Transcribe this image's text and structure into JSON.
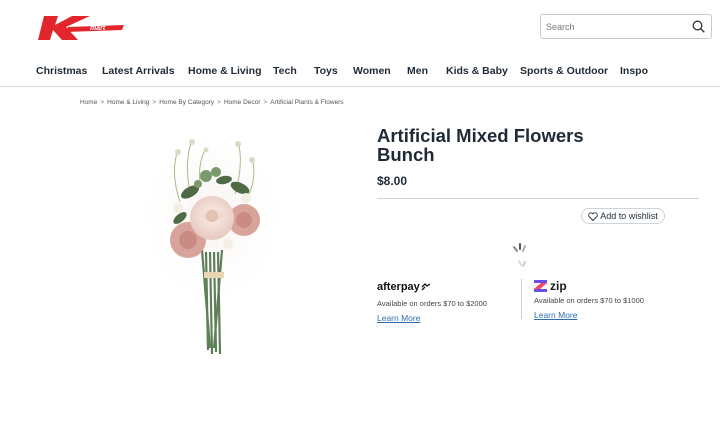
{
  "header": {
    "logo_text": "Kmart",
    "search": {
      "placeholder": "Search",
      "value": ""
    }
  },
  "nav": {
    "items": [
      "Christmas",
      "Latest Arrivals",
      "Home & Living",
      "Tech",
      "Toys",
      "Women",
      "Men",
      "Kids & Baby",
      "Sports & Outdoor",
      "Inspo"
    ]
  },
  "breadcrumb": [
    "Home",
    "Home & Living",
    "Home By Category",
    "Home Decor",
    "Artificial Plants & Flowers"
  ],
  "breadcrumb_separator": ">",
  "product": {
    "title": "Artificial Mixed Flowers Bunch",
    "price": "$8.00",
    "wishlist_label": "Add to wishlist"
  },
  "payments": {
    "afterpay": {
      "name": "afterpay",
      "text": "Available on orders $70 to $2000",
      "link": "Learn More"
    },
    "zip": {
      "name": "zip",
      "text": "Available on orders $70 to $1000",
      "link": "Learn More"
    }
  },
  "colors": {
    "brand_red": "#e3262c",
    "text_dark": "#1f2a37",
    "link_blue": "#2f6fb2"
  }
}
